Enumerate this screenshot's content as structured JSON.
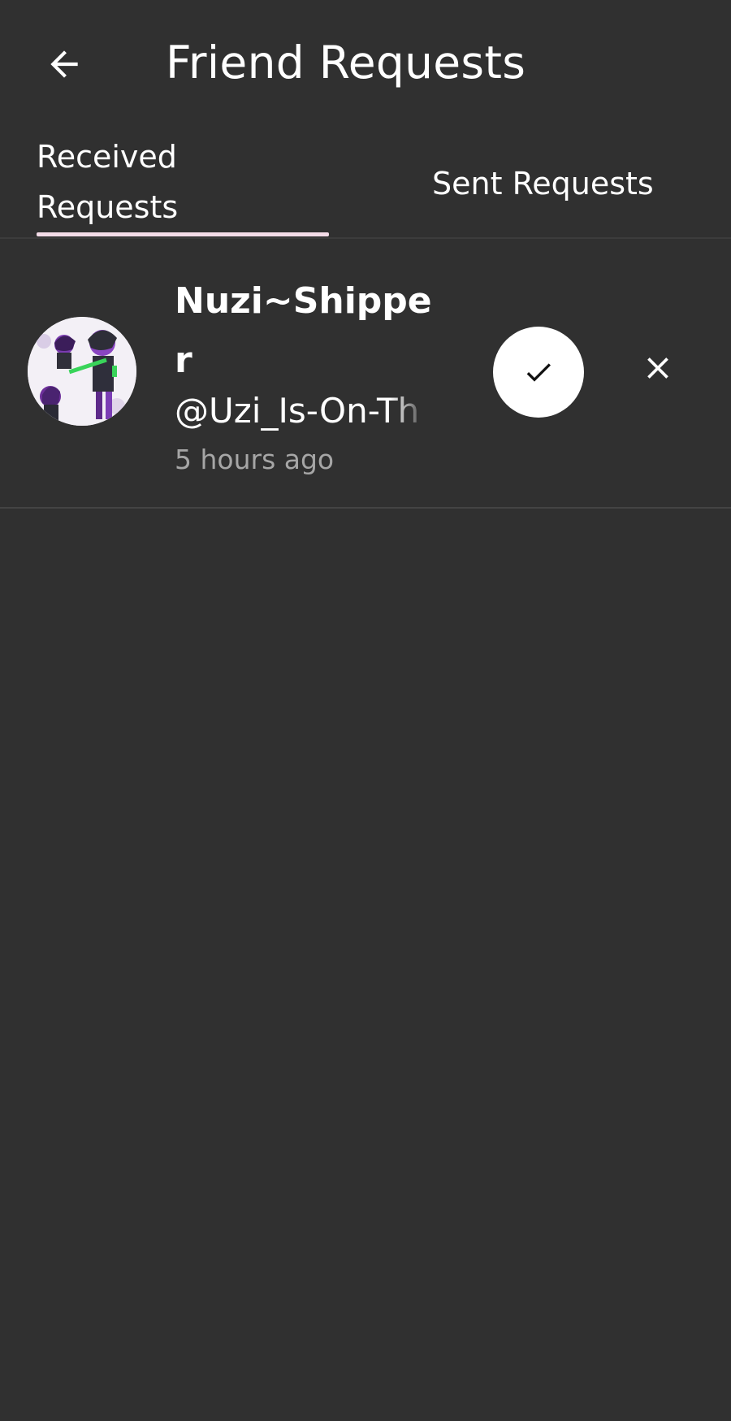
{
  "header": {
    "title": "Friend Requests",
    "back_icon": "arrow-left-icon"
  },
  "tabs": [
    {
      "label": "Received\nRequests",
      "active": true
    },
    {
      "label": "Sent Requests",
      "active": false
    }
  ],
  "colors": {
    "background": "#303030",
    "tab_indicator": "#f4dce8",
    "text_primary": "#ffffff",
    "text_secondary": "#a6a6a6",
    "accept_button": "#ffffff"
  },
  "requests": [
    {
      "display_name": "Nuzi~Shipper",
      "handle": "@Uzi_Is-On-Th",
      "time_ago": "5 hours ago",
      "accept_icon": "checkmark-icon",
      "decline_icon": "close-icon"
    }
  ]
}
